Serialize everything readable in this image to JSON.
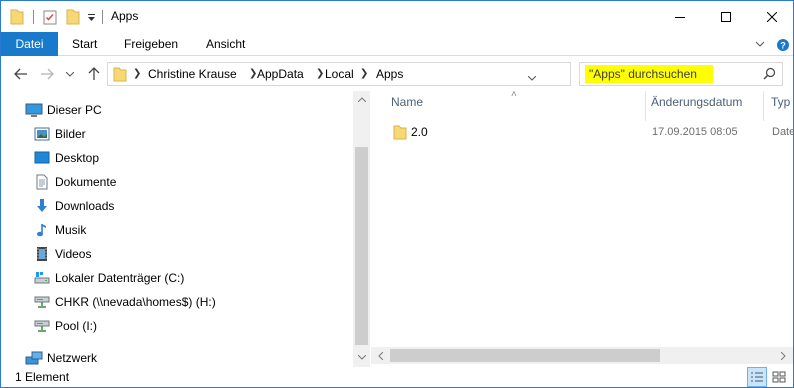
{
  "window": {
    "title": "Apps"
  },
  "ribbon": {
    "tabs": [
      "Datei",
      "Start",
      "Freigeben",
      "Ansicht"
    ]
  },
  "address": {
    "crumbs": [
      "Christine Krause",
      "AppData",
      "Local",
      "Apps"
    ]
  },
  "search": {
    "placeholder": "\"Apps\" durchsuchen"
  },
  "nav": {
    "items": [
      {
        "label": "Dieser PC",
        "icon": "pc-icon"
      },
      {
        "label": "Bilder",
        "icon": "pictures-icon"
      },
      {
        "label": "Desktop",
        "icon": "desktop-icon"
      },
      {
        "label": "Dokumente",
        "icon": "documents-icon"
      },
      {
        "label": "Downloads",
        "icon": "downloads-icon"
      },
      {
        "label": "Musik",
        "icon": "music-icon"
      },
      {
        "label": "Videos",
        "icon": "videos-icon"
      },
      {
        "label": "Lokaler Datenträger (C:)",
        "icon": "local-drive-icon"
      },
      {
        "label": "CHKR (\\\\nevada\\homes$) (H:)",
        "icon": "network-drive-icon"
      },
      {
        "label": "Pool (I:)",
        "icon": "network-drive-icon"
      },
      {
        "label": "Netzwerk",
        "icon": "network-icon"
      }
    ]
  },
  "list": {
    "columns": [
      "Name",
      "Änderungsdatum",
      "Typ"
    ],
    "rows": [
      {
        "name": "2.0",
        "date": "17.09.2015 08:05",
        "type": "Date"
      }
    ]
  },
  "status": {
    "count": "1 Element"
  },
  "colors": {
    "accent": "#1979ca",
    "search_highlight": "#ffff00",
    "folder": "#f8d775"
  }
}
